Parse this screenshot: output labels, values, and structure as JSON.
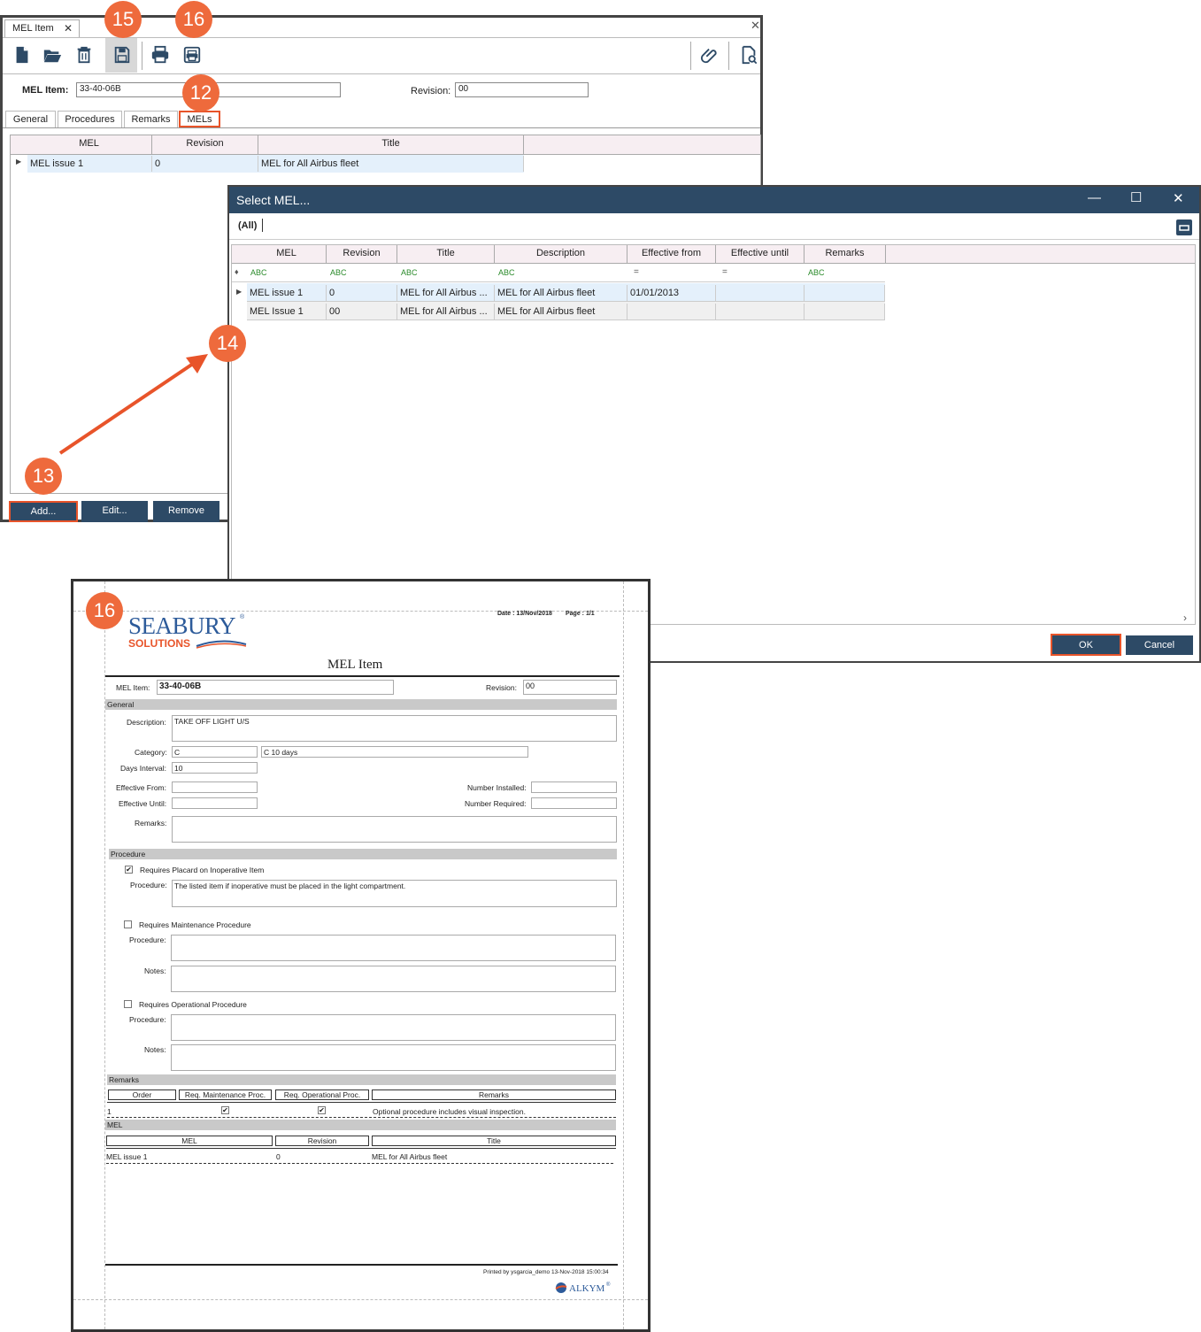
{
  "main_window": {
    "tab_title": "MEL Item",
    "tab_close": "✕",
    "window_close": "✕",
    "mel_item_label": "MEL Item:",
    "mel_item_value": "33-40-06B",
    "revision_label": "Revision:",
    "revision_value": "00",
    "tabs": [
      "General",
      "Procedures",
      "Remarks",
      "MELs"
    ],
    "grid_headers": [
      "MEL",
      "Revision",
      "Title"
    ],
    "grid_rows": [
      {
        "mel": "MEL issue 1",
        "revision": "0",
        "title": "MEL for All Airbus fleet"
      }
    ],
    "buttons": {
      "add": "Add...",
      "edit": "Edit...",
      "remove": "Remove"
    }
  },
  "toolbar_icons": [
    "new-file-icon",
    "open-folder-icon",
    "delete-icon",
    "save-icon",
    "print-icon",
    "print-preview-icon",
    "attachment-icon",
    "document-search-icon"
  ],
  "badges": {
    "b15": "15",
    "b16a": "16",
    "b12": "12",
    "b13": "13",
    "b14": "14",
    "b16b": "16"
  },
  "select_dialog": {
    "title": "Select MEL...",
    "group_label": "(All)",
    "headers": [
      "MEL",
      "Revision",
      "Title",
      "Description",
      "Effective from",
      "Effective until",
      "Remarks"
    ],
    "filter_abc": "ABC",
    "filter_eq": "=",
    "rows": [
      {
        "mel": "MEL issue 1",
        "revision": "0",
        "title": "MEL for All Airbus ...",
        "description": "MEL for All Airbus fleet",
        "from": "01/01/2013",
        "until": "",
        "remarks": ""
      },
      {
        "mel": "MEL Issue 1",
        "revision": "00",
        "title": "MEL for All Airbus ...",
        "description": "MEL for All Airbus fleet",
        "from": "",
        "until": "",
        "remarks": ""
      }
    ],
    "ok": "OK",
    "cancel": "Cancel"
  },
  "report": {
    "logo_top": "SEABURY",
    "logo_reg": "®",
    "logo_bottom": "SOLUTIONS",
    "date": "Date : 13/Nov/2018",
    "page": "Page : 1/1",
    "title": "MEL Item",
    "mel_item_label": "MEL Item:",
    "mel_item_value": "33-40-06B",
    "revision_label": "Revision:",
    "revision_value": "00",
    "sec_general": "General",
    "description_label": "Description:",
    "description_value": "TAKE OFF LIGHT U/S",
    "category_label": "Category:",
    "category_value": "C",
    "category_desc": "C 10 days",
    "days_label": "Days Interval:",
    "days_value": "10",
    "eff_from_label": "Effective From:",
    "eff_until_label": "Effective Until:",
    "num_installed_label": "Number Installed:",
    "num_required_label": "Number Required:",
    "remarks_label": "Remarks:",
    "sec_procedure": "Procedure",
    "req_placard": "Requires Placard on Inoperative Item",
    "procedure_label": "Procedure:",
    "placard_procedure": "The listed item if inoperative must be placed in the light compartment.",
    "req_maint": "Requires Maintenance Procedure",
    "notes_label": "Notes:",
    "req_oper": "Requires Operational Procedure",
    "sec_remarks": "Remarks",
    "remarks_cols": [
      "Order",
      "Req. Maintenance Proc.",
      "Req. Operational Proc.",
      "Remarks"
    ],
    "remarks_row": {
      "order": "1",
      "remarks": "Optional procedure includes visual inspection."
    },
    "sec_mel": "MEL",
    "mel_cols": [
      "MEL",
      "Revision",
      "Title"
    ],
    "mel_row": {
      "mel": "MEL issue 1",
      "revision": "0",
      "title": "MEL for All Airbus fleet"
    },
    "printed_by": "Printed by ysgarcia_demo 13-Nov-2018 15:00:34",
    "footer_logo": "ALKYM",
    "footer_reg": "®"
  },
  "colors": {
    "accent_orange": "#ee6a3c",
    "navy": "#2d4a66"
  }
}
